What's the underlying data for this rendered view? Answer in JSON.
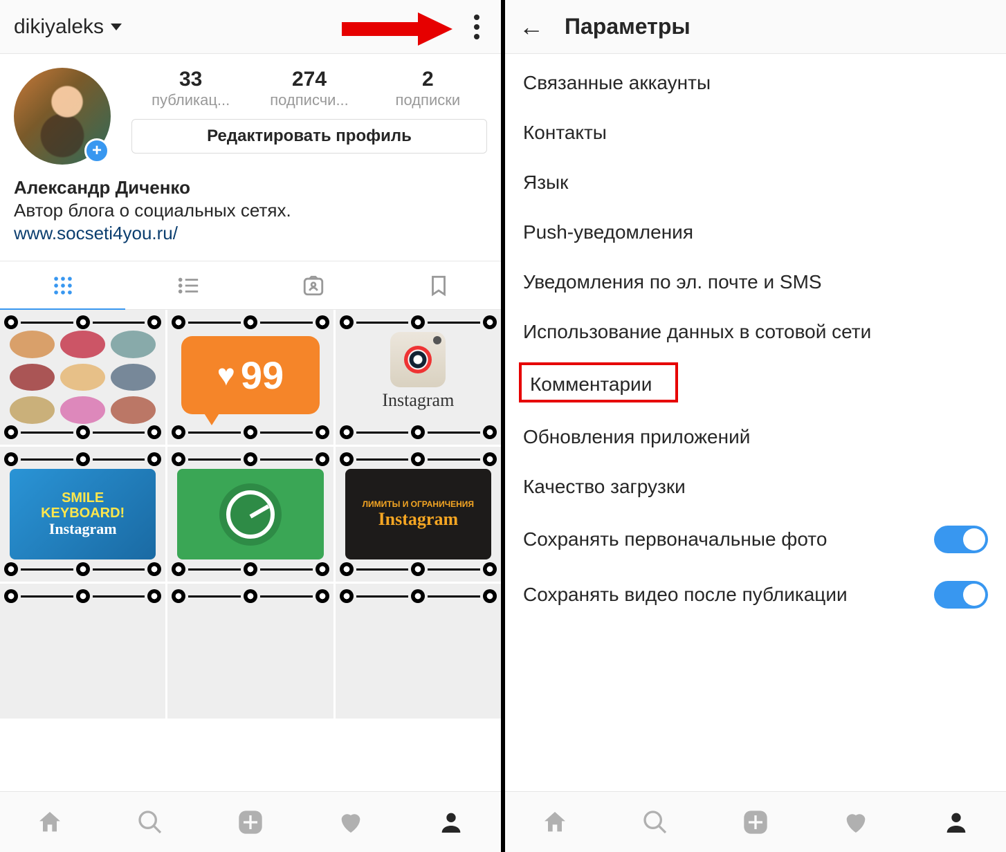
{
  "left": {
    "username": "dikiyaleks",
    "stats": {
      "posts": {
        "count": "33",
        "label": "публикац..."
      },
      "followers": {
        "count": "274",
        "label": "подписчи..."
      },
      "following": {
        "count": "2",
        "label": "подписки"
      }
    },
    "edit_label": "Редактировать профиль",
    "bio": {
      "name": "Александр Диченко",
      "desc": "Автор блога о социальных сетях.",
      "link": "www.socseti4you.ru/"
    },
    "posts": {
      "p2_likes": "99",
      "p3_text": "Instagram",
      "p4_line1": "SMILE",
      "p4_line2": "KEYBOARD!",
      "p4_brand": "Instagram",
      "p6_line1": "ЛИМИТЫ И ОГРАНИЧЕНИЯ",
      "p6_brand": "Instagram"
    }
  },
  "right": {
    "title": "Параметры",
    "items": [
      {
        "label": "Связанные аккаунты"
      },
      {
        "label": "Контакты"
      },
      {
        "label": "Язык"
      },
      {
        "label": "Push-уведомления"
      },
      {
        "label": "Уведомления по эл. почте и SMS"
      },
      {
        "label": "Использование данных в сотовой сети"
      },
      {
        "label": "Комментарии",
        "highlight": true
      },
      {
        "label": "Обновления приложений"
      },
      {
        "label": "Качество загрузки"
      },
      {
        "label": "Сохранять первоначальные фото",
        "toggle": true
      },
      {
        "label": "Сохранять видео после публикации",
        "toggle": true
      }
    ]
  },
  "colors": {
    "accent": "#3897f0",
    "annotation": "#e60000",
    "orange": "#f58529"
  }
}
